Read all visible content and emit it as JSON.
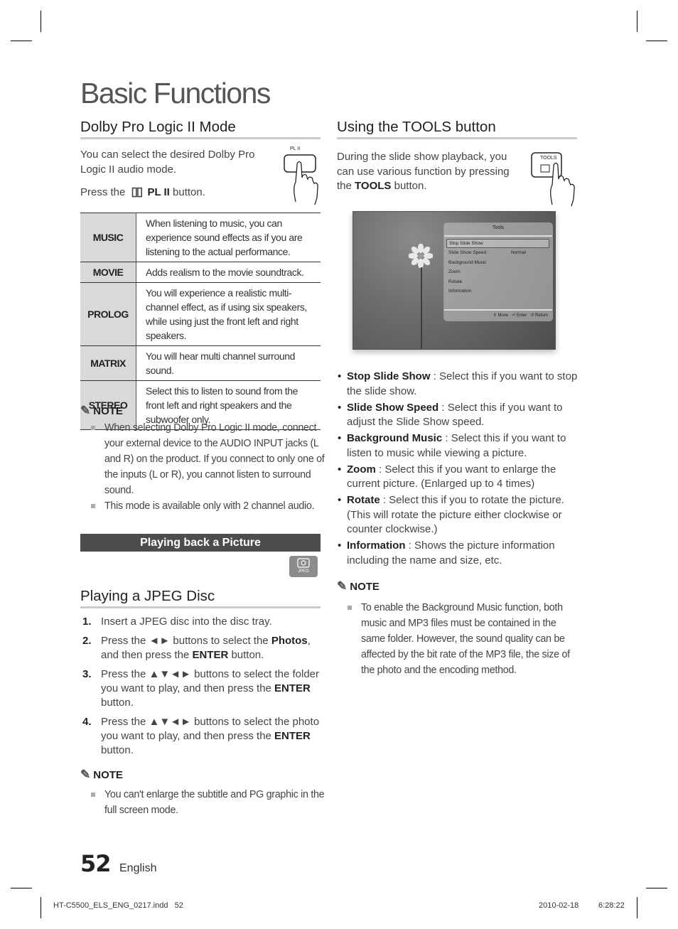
{
  "page_title": "Basic Functions",
  "dolby": {
    "heading": "Dolby Pro Logic II Mode",
    "intro": "You can select the desired Dolby Pro Logic II audio mode.",
    "press_prefix": "Press the",
    "press_button": "PL II",
    "press_suffix": "button.",
    "remote_button_label": "PL II",
    "modes": [
      {
        "mode": "MUSIC",
        "desc": "When listening to music, you can experience sound effects as if you are listening to the actual performance."
      },
      {
        "mode": "MOVIE",
        "desc": "Adds realism to the movie soundtrack."
      },
      {
        "mode": "PROLOG",
        "desc": "You will experience a realistic multi-channel effect, as if using six speakers, while using just the front left and right speakers."
      },
      {
        "mode": "MATRIX",
        "desc": "You will hear multi channel surround sound."
      },
      {
        "mode": "STEREO",
        "desc": "Select this to listen to sound from the front left and right speakers and the subwoofer only."
      }
    ],
    "note_title": "NOTE",
    "notes": [
      "When selecting Dolby Pro Logic II mode, connect your external device to the AUDIO INPUT jacks (L and R) on the product. If you connect to only one of the inputs (L or R), you cannot listen to surround sound.",
      "This mode is available only with 2 channel audio."
    ]
  },
  "picture_banner": "Playing back a Picture",
  "jpeg_badge": "JPEG",
  "jpeg": {
    "heading": "Playing a JPEG Disc",
    "steps": [
      {
        "num": "1.",
        "parts": [
          {
            "t": "Insert a JPEG disc into the disc tray.",
            "b": false
          }
        ]
      },
      {
        "num": "2.",
        "parts": [
          {
            "t": "Press the ◄► buttons to select the ",
            "b": false
          },
          {
            "t": "Photos",
            "b": true
          },
          {
            "t": ", and then press the ",
            "b": false
          },
          {
            "t": "ENTER",
            "b": true
          },
          {
            "t": " button.",
            "b": false
          }
        ]
      },
      {
        "num": "3.",
        "parts": [
          {
            "t": "Press the ▲▼◄► buttons to select the folder you want to play, and then press the ",
            "b": false
          },
          {
            "t": "ENTER",
            "b": true
          },
          {
            "t": " button.",
            "b": false
          }
        ]
      },
      {
        "num": "4.",
        "parts": [
          {
            "t": "Press the ▲▼◄► buttons to select the photo you want to play, and then press the ",
            "b": false
          },
          {
            "t": "ENTER",
            "b": true
          },
          {
            "t": " button.",
            "b": false
          }
        ]
      }
    ],
    "note_title": "NOTE",
    "notes": [
      "You can't enlarge the subtitle and PG graphic in the full screen mode."
    ]
  },
  "tools": {
    "heading": "Using the TOOLS button",
    "intro_prefix": "During the slide show playback, you can use various function by pressing the ",
    "intro_bold": "TOOLS",
    "intro_suffix": " button.",
    "remote_button_label": "TOOLS",
    "menu": {
      "title": "Tools",
      "items": [
        {
          "label": "Stop Slide Show",
          "value": "",
          "selected": true
        },
        {
          "label": "Slide Show Speed :",
          "value": "Normal",
          "selected": false
        },
        {
          "label": "Background Music",
          "value": "",
          "selected": false
        },
        {
          "label": "Zoom",
          "value": "",
          "selected": false
        },
        {
          "label": "Rotate",
          "value": "",
          "selected": false
        },
        {
          "label": "Information",
          "value": "",
          "selected": false
        }
      ],
      "footer": {
        "move": "Move",
        "enter": "Enter",
        "return": "Return"
      }
    },
    "bullets": [
      {
        "term": "Stop Slide Show",
        "desc": " : Select this if you want to stop the slide show."
      },
      {
        "term": "Slide Show Speed",
        "desc": " : Select this if you want to adjust the Slide Show speed."
      },
      {
        "term": "Background Music",
        "desc": " : Select this if you want to listen to music while viewing a picture."
      },
      {
        "term": "Zoom",
        "desc": " : Select this if you want to enlarge the current picture. (Enlarged up to 4 times)"
      },
      {
        "term": "Rotate",
        "desc": " : Select this if you to rotate the picture. (This will rotate the picture either clockwise or counter clockwise.)"
      },
      {
        "term": "Information",
        "desc": " : Shows the picture information including the name and size, etc."
      }
    ],
    "note_title": "NOTE",
    "notes": [
      "To enable the Background Music function, both music and MP3 files must be contained in the same folder. However, the sound quality can be affected by the bit rate of the MP3 file, the size of the photo and the encoding method."
    ]
  },
  "footer": {
    "page_number": "52",
    "language": "English",
    "slug_file": "HT-C5500_ELS_ENG_0217.indd   52",
    "slug_date": "2010-02-18",
    "slug_time": "6:28:22"
  }
}
